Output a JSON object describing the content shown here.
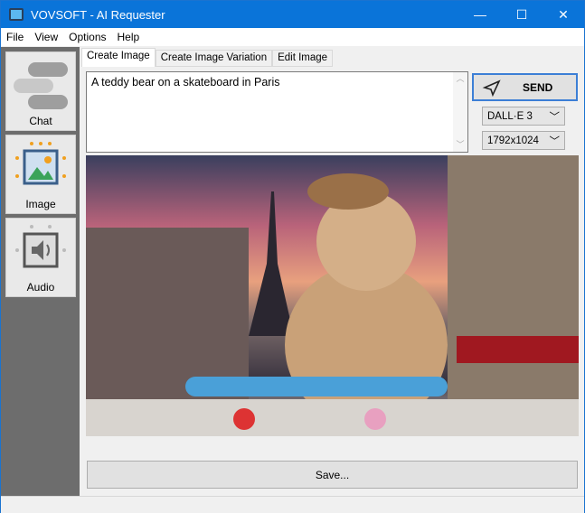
{
  "window": {
    "title": "VOVSOFT - AI Requester",
    "minimize": "—",
    "maximize": "☐",
    "close": "✕"
  },
  "menu": [
    "File",
    "View",
    "Options",
    "Help"
  ],
  "sidebar": [
    {
      "label": "Chat",
      "icon": "chat-bubbles-icon"
    },
    {
      "label": "Image",
      "icon": "image-chip-icon"
    },
    {
      "label": "Audio",
      "icon": "speaker-chip-icon"
    }
  ],
  "tabs": [
    {
      "label": "Create Image",
      "active": true
    },
    {
      "label": "Create Image Variation"
    },
    {
      "label": "Edit Image"
    }
  ],
  "prompt": {
    "value": "A teddy bear on a skateboard in Paris"
  },
  "send_label": "SEND",
  "model": {
    "selected": "DALL·E 3"
  },
  "size": {
    "selected": "1792x1024"
  },
  "save_label": "Save..."
}
